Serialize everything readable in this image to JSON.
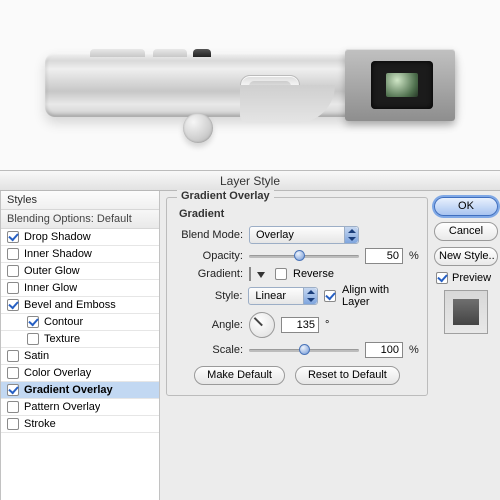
{
  "dialog": {
    "title": "Layer Style"
  },
  "left": {
    "styles_header": "Styles",
    "blending_header": "Blending Options: Default",
    "items": [
      {
        "label": "Drop Shadow",
        "checked": true
      },
      {
        "label": "Inner Shadow",
        "checked": false
      },
      {
        "label": "Outer Glow",
        "checked": false
      },
      {
        "label": "Inner Glow",
        "checked": false
      },
      {
        "label": "Bevel and Emboss",
        "checked": true
      },
      {
        "label": "Contour",
        "checked": true,
        "sub": true
      },
      {
        "label": "Texture",
        "checked": false,
        "sub": true
      },
      {
        "label": "Satin",
        "checked": false
      },
      {
        "label": "Color Overlay",
        "checked": false
      },
      {
        "label": "Gradient Overlay",
        "checked": true,
        "selected": true
      },
      {
        "label": "Pattern Overlay",
        "checked": false
      },
      {
        "label": "Stroke",
        "checked": false
      }
    ]
  },
  "panel": {
    "title": "Gradient Overlay",
    "subtitle": "Gradient",
    "blend_mode_label": "Blend Mode:",
    "blend_mode_value": "Overlay",
    "opacity_label": "Opacity:",
    "opacity_value": "50",
    "opacity_pct": 50,
    "pct_sign": "%",
    "gradient_label": "Gradient:",
    "reverse_label": "Reverse",
    "reverse_checked": false,
    "style_label": "Style:",
    "style_value": "Linear",
    "align_label": "Align with Layer",
    "align_checked": true,
    "angle_label": "Angle:",
    "angle_value": "135",
    "angle_deg": "°",
    "scale_label": "Scale:",
    "scale_value": "100",
    "scale_pct": 100,
    "make_default": "Make Default",
    "reset_default": "Reset to Default"
  },
  "right": {
    "ok": "OK",
    "cancel": "Cancel",
    "new_style": "New Style..",
    "preview": "Preview",
    "preview_checked": true
  }
}
